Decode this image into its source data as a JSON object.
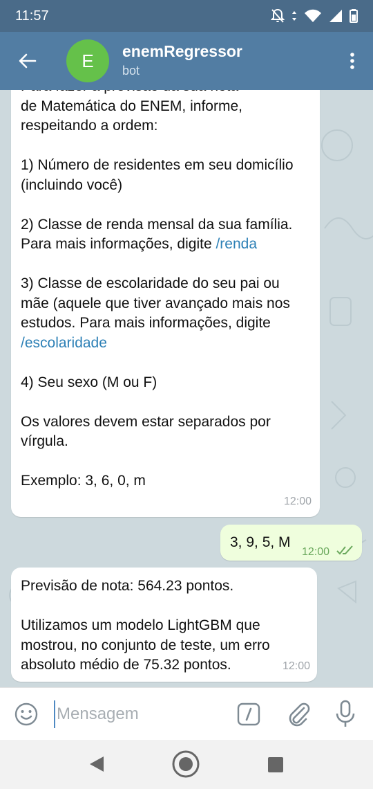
{
  "status_bar": {
    "time": "11:57"
  },
  "header": {
    "avatar_letter": "E",
    "title": "enemRegressor",
    "subtitle": "bot"
  },
  "messages": {
    "m1": {
      "cut_line": "Para fazer a previsão da sua nota",
      "p1": "de Matemática do ENEM, informe, respeitando a ordem:",
      "p2": "1) Número de residentes em seu domicílio (incluindo você)",
      "p3_text": "2) Classe de renda mensal da sua família. Para mais informações, digite ",
      "p3_link": "/renda",
      "p4_text": "3) Classe de escolaridade do seu pai ou mãe (aquele que tiver avançado mais nos estudos. Para mais informações, digite ",
      "p4_link": "/escolaridade",
      "p5": "4) Seu sexo (M ou F)",
      "p6": "Os valores devem estar separados por vírgula.",
      "p7": "Exemplo: 3, 6, 0, m",
      "time": "12:00"
    },
    "m2": {
      "text": "3, 9, 5, M",
      "time": "12:00"
    },
    "m3": {
      "p1": "Previsão de nota: 564.23 pontos.",
      "p2": "Utilizamos um modelo LightGBM que mostrou, no conjunto de teste, um erro absoluto médio de 75.32 pontos.",
      "time": "12:00"
    }
  },
  "composer": {
    "placeholder": "Mensagem"
  },
  "colors": {
    "header": "#527da3",
    "status_bar": "#4a6b89",
    "avatar": "#65c14a",
    "link": "#2d80b6",
    "outgoing_bubble": "#effedd"
  },
  "icons": [
    "back-arrow-icon",
    "more-vert-icon",
    "emoji-icon",
    "bot-command-icon",
    "attach-icon",
    "mic-icon",
    "read-checkmarks-icon"
  ]
}
